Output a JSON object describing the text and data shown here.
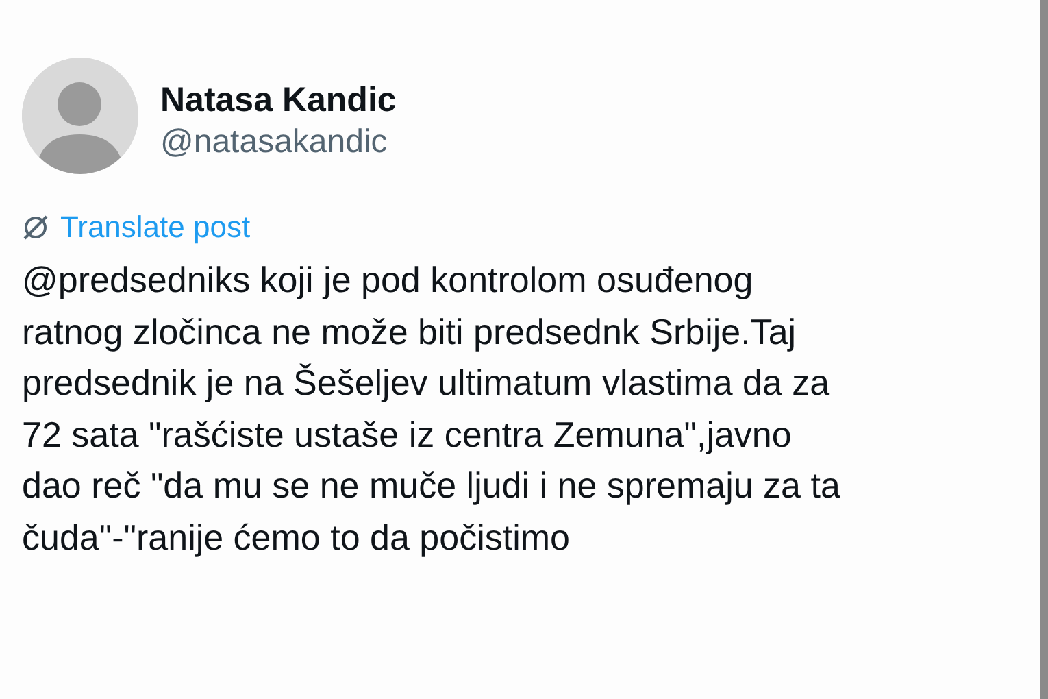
{
  "author": {
    "name": "Natasa Kandic",
    "handle": "@natasakandic"
  },
  "translate": {
    "label": "Translate post"
  },
  "post": {
    "text_lines": [
      "@predsedniks koji je pod kontrolom osuđenog",
      "ratnog zločinca ne može biti predsednk Srbije.Taj",
      "predsednik je na Šešeljev ultimatum vlastima da za",
      "72 sata \"rašćiste ustaše iz centra Zemuna\",javno",
      "dao reč \"da mu se ne muče ljudi i ne spremaju za ta",
      "čuda\"-\"ranije ćemo to da počistimo"
    ]
  }
}
